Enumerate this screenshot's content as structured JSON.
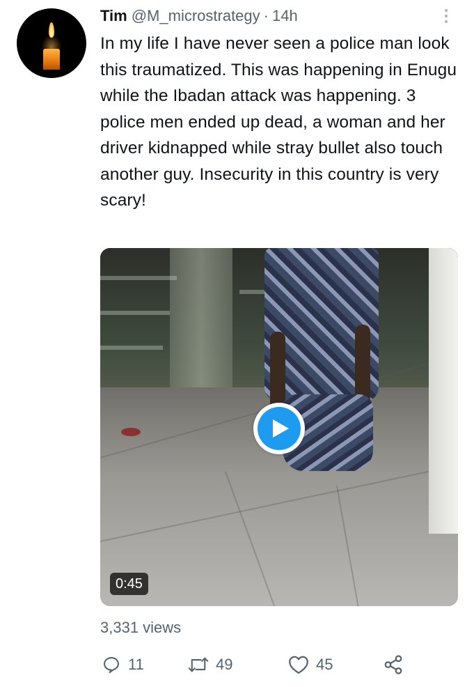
{
  "tweet": {
    "author_name": "Tim",
    "handle": "@M_microstrategy",
    "separator": "·",
    "time": "14h",
    "text": "In my life I have never seen a police man look this traumatized. This was happening in Enugu while the Ibadan attack was happening. 3 police men ended up dead, a woman and her driver kidnapped while stray bullet also touch another guy. Insecurity in this country is very scary!",
    "avatar_icon": "candle-icon",
    "more_icon": "more-vertical-icon"
  },
  "video": {
    "duration": "0:45",
    "play_icon": "play-icon",
    "accent_color": "#1d9bf0"
  },
  "stats": {
    "views": "3,331 views"
  },
  "actions": {
    "reply": {
      "icon": "reply-icon",
      "count": "11"
    },
    "retweet": {
      "icon": "retweet-icon",
      "count": "49"
    },
    "like": {
      "icon": "heart-icon",
      "count": "45"
    },
    "share": {
      "icon": "share-icon"
    }
  },
  "colors": {
    "text": "#0f1419",
    "secondary": "#536471"
  }
}
